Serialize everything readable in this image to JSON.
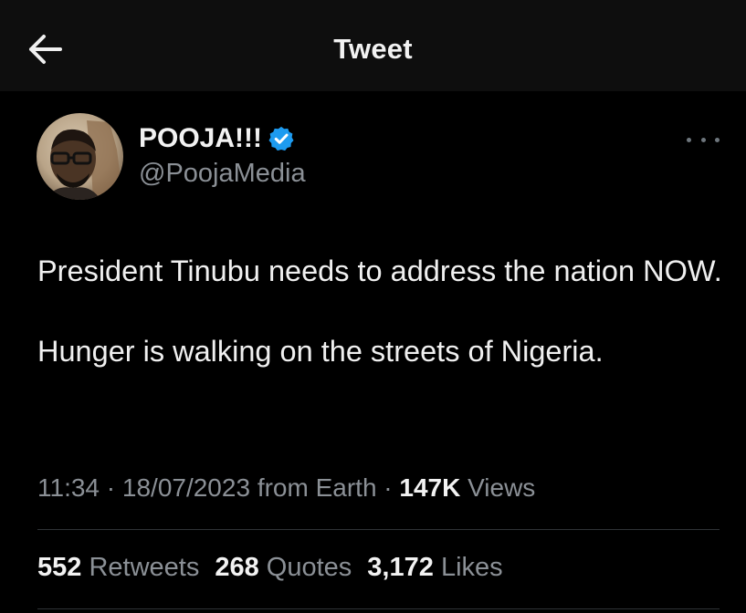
{
  "header": {
    "title": "Tweet",
    "back_icon": "arrow-left-icon"
  },
  "author": {
    "display_name": "POOJA!!!",
    "handle": "@PoojaMedia",
    "verified": true,
    "verified_color": "#1d9bf0",
    "avatar_icon": "avatar-photo"
  },
  "tweet": {
    "lines": [
      "President Tinubu needs to address the nation NOW.",
      "Hunger is walking on the streets of Nigeria."
    ],
    "time": "11:34",
    "date": "18/07/2023",
    "source": "from Earth",
    "views_count": "147K",
    "views_label": "Views"
  },
  "stats": {
    "retweets_count": "552",
    "retweets_label": "Retweets",
    "quotes_count": "268",
    "quotes_label": "Quotes",
    "likes_count": "3,172",
    "likes_label": "Likes"
  },
  "colors": {
    "background": "#000000",
    "header_background": "#0e0e0e",
    "secondary_text": "#8b9096",
    "primary_text": "#f2f2f2"
  }
}
